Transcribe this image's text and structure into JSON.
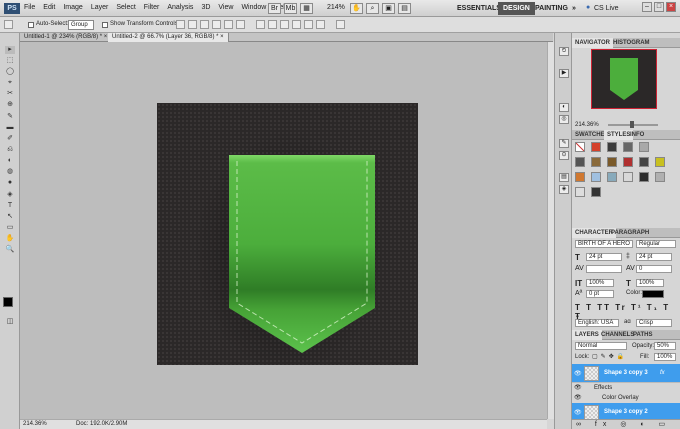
{
  "app": {
    "logo": "PS"
  },
  "menubar": {
    "items": [
      "File",
      "Edit",
      "Image",
      "Layer",
      "Select",
      "Filter",
      "Analysis",
      "3D",
      "View",
      "Window",
      "Help"
    ],
    "zoom": "214%",
    "workspaces": {
      "essentials": "ESSENTIALS",
      "design": "DESIGN",
      "painting": "PAINTING",
      "more": "»"
    },
    "cs_live": "CS Live",
    "window_buttons": {
      "minimize": "–",
      "restore": "□",
      "close": "×"
    }
  },
  "options": {
    "auto_select_label": "Auto-Select:",
    "auto_select_value": "Group",
    "show_transform_label": "Show Transform Controls"
  },
  "tabs": [
    {
      "label": "Untitled-1 @ 234% (RGB/8) *",
      "close": "×"
    },
    {
      "label": "Untitled-2 @ 66.7% (Layer 36, RGB/8) *",
      "close": "×"
    }
  ],
  "tools": [
    "▸",
    "⬚",
    "◯",
    "⌖",
    "✂",
    "⊕",
    "✎",
    "▬",
    "✐",
    "⎌",
    "◐",
    "◍",
    "●",
    "◈",
    "T",
    "↖",
    "▭",
    "✋",
    "🔍"
  ],
  "status": {
    "zoom": "214.36%",
    "doc": "Doc: 192.0K/2.90M"
  },
  "navigator": {
    "tabs": [
      "NAVIGATOR",
      "HISTOGRAM"
    ],
    "zoom": "214.36%"
  },
  "swatches": {
    "tabs": [
      "SWATCHES",
      "STYLES",
      "INFO"
    ]
  },
  "styles_colors": [
    "#ffffff",
    "#d4412b",
    "#3a3a3a",
    "#666666",
    "#a9a9a9",
    "#555555",
    "#8a6a3a",
    "#7a5a2a",
    "#444444",
    "#b03030",
    "#88aabb",
    "#c8c020",
    "#d07830",
    "#a0c0e0",
    "#d8d8d8",
    "#2c2c2c",
    "#b0b0b0",
    "#8888aa",
    "#c0c0c0",
    "#dddddd",
    "#333333"
  ],
  "character": {
    "tabs": [
      "CHARACTER",
      "PARAGRAPH"
    ],
    "font": "BIRTH OF A HERO",
    "style": "Regular",
    "size": "24 pt",
    "leading": "24 pt",
    "kerning": "",
    "tracking": "0",
    "scale_v": "100%",
    "scale_h": "100%",
    "baseline": "0 pt",
    "color_label": "Color:",
    "language": "English: USA",
    "aa_label": "aɑ",
    "antialias": "Crisp"
  },
  "layers": {
    "tabs": [
      "LAYERS",
      "CHANNELS",
      "PATHS"
    ],
    "blend": "Normal",
    "opacity_label": "Opacity:",
    "opacity": "50%",
    "lock_label": "Lock:",
    "fill_label": "Fill:",
    "fill": "100%",
    "items": [
      {
        "name": "Shape 3 copy 3",
        "fx": "fx"
      },
      {
        "name": "Effects"
      },
      {
        "name": "Color Overlay"
      },
      {
        "name": "Shape 3 copy 2"
      }
    ]
  }
}
